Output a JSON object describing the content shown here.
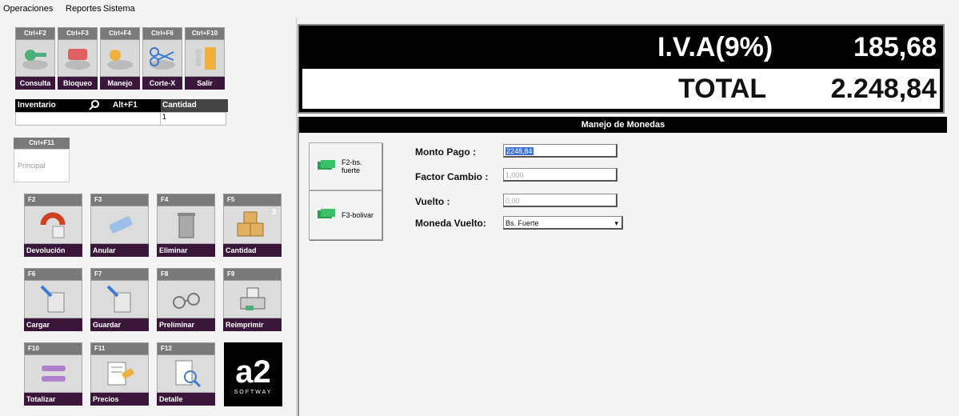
{
  "menu": [
    "Operaciones",
    "Reportes",
    "Sistema"
  ],
  "top_buttons": [
    {
      "key": "Ctrl+F2",
      "label": "Consulta",
      "icon": "consulta-icon"
    },
    {
      "key": "Ctrl+F3",
      "label": "Bloqueo",
      "icon": "bloqueo-icon"
    },
    {
      "key": "Ctrl+F4",
      "label": "Manejo",
      "icon": "manejo-icon"
    },
    {
      "key": "Ctrl+F6",
      "label": "Corte-X",
      "icon": "scissors-icon"
    },
    {
      "key": "Ctrl+F10",
      "label": "Salir",
      "icon": "exit-door-icon"
    }
  ],
  "inventory": {
    "label": "Inventario",
    "shortcut": "Alt+F1",
    "qty_label": "Cantidad",
    "qty_value": "1"
  },
  "principal": {
    "key": "Ctrl+F11",
    "label": "Principal"
  },
  "function_buttons": [
    {
      "key": "F2",
      "label": "Devolución"
    },
    {
      "key": "F3",
      "label": "Anular"
    },
    {
      "key": "F4",
      "label": "Eliminar"
    },
    {
      "key": "F5",
      "label": "Cantidad",
      "badge": "3"
    },
    {
      "key": "F6",
      "label": "Cargar"
    },
    {
      "key": "F7",
      "label": "Guardar"
    },
    {
      "key": "F8",
      "label": "Preliminar"
    },
    {
      "key": "F9",
      "label": "Reimprimir"
    },
    {
      "key": "F10",
      "label": "Totalizar"
    },
    {
      "key": "F11",
      "label": "Precios"
    },
    {
      "key": "F12",
      "label": "Detalle"
    }
  ],
  "logo": {
    "mark": "a2",
    "sub": "SOFTWAY"
  },
  "totals": {
    "iva_label": "I.V.A(9%)",
    "iva_value": "185,68",
    "total_label": "TOTAL",
    "total_value": "2.248,84"
  },
  "currency_panel": {
    "title": "Manejo de Monedas",
    "buttons": [
      "F2-bs. fuerte",
      "F3-bolivar"
    ],
    "fields": {
      "monto_label": "Monto Pago :",
      "monto_value": "2248,84",
      "factor_label": "Factor Cambio :",
      "factor_value": "1,000",
      "vuelto_label": "Vuelto :",
      "vuelto_value": "0,00",
      "moneda_label": "Moneda Vuelto:",
      "moneda_value": "Bs. Fuerte"
    }
  },
  "colors": {
    "label_bg": "#3a163a",
    "key_bg": "#7a7a7a",
    "selection": "#3b6fd6"
  }
}
